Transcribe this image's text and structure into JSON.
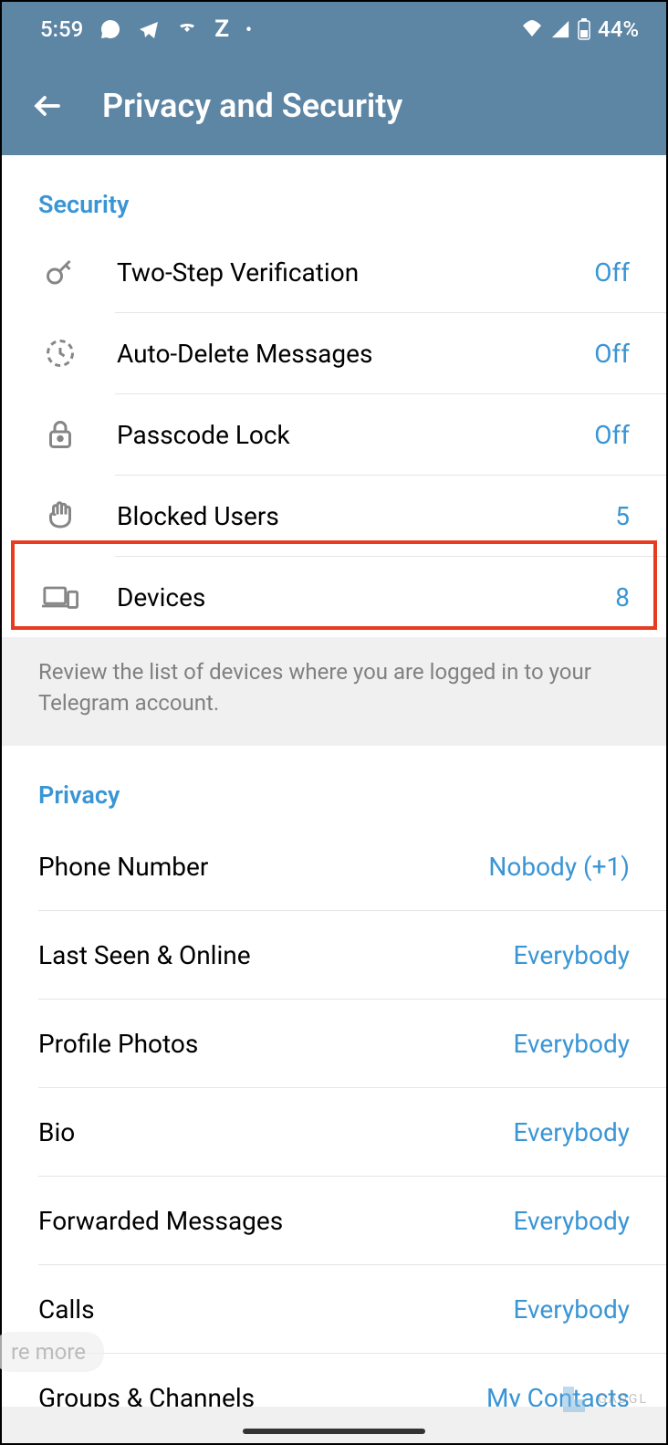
{
  "status": {
    "time": "5:59",
    "battery": "44%"
  },
  "header": {
    "title": "Privacy and Security"
  },
  "security": {
    "title": "Security",
    "items": [
      {
        "label": "Two-Step Verification",
        "value": "Off"
      },
      {
        "label": "Auto-Delete Messages",
        "value": "Off"
      },
      {
        "label": "Passcode Lock",
        "value": "Off"
      },
      {
        "label": "Blocked Users",
        "value": "5"
      },
      {
        "label": "Devices",
        "value": "8"
      }
    ],
    "footer": "Review the list of devices where you are logged in to your Telegram account."
  },
  "privacy": {
    "title": "Privacy",
    "items": [
      {
        "label": "Phone Number",
        "value": "Nobody (+1)"
      },
      {
        "label": "Last Seen & Online",
        "value": "Everybody"
      },
      {
        "label": "Profile Photos",
        "value": "Everybody"
      },
      {
        "label": "Bio",
        "value": "Everybody"
      },
      {
        "label": "Forwarded Messages",
        "value": "Everybody"
      },
      {
        "label": "Calls",
        "value": "Everybody"
      },
      {
        "label": "Groups & Channels",
        "value": "My Contacts"
      }
    ]
  },
  "overlay": {
    "re_more": "re more"
  },
  "watermark": {
    "text": "GADGL"
  }
}
